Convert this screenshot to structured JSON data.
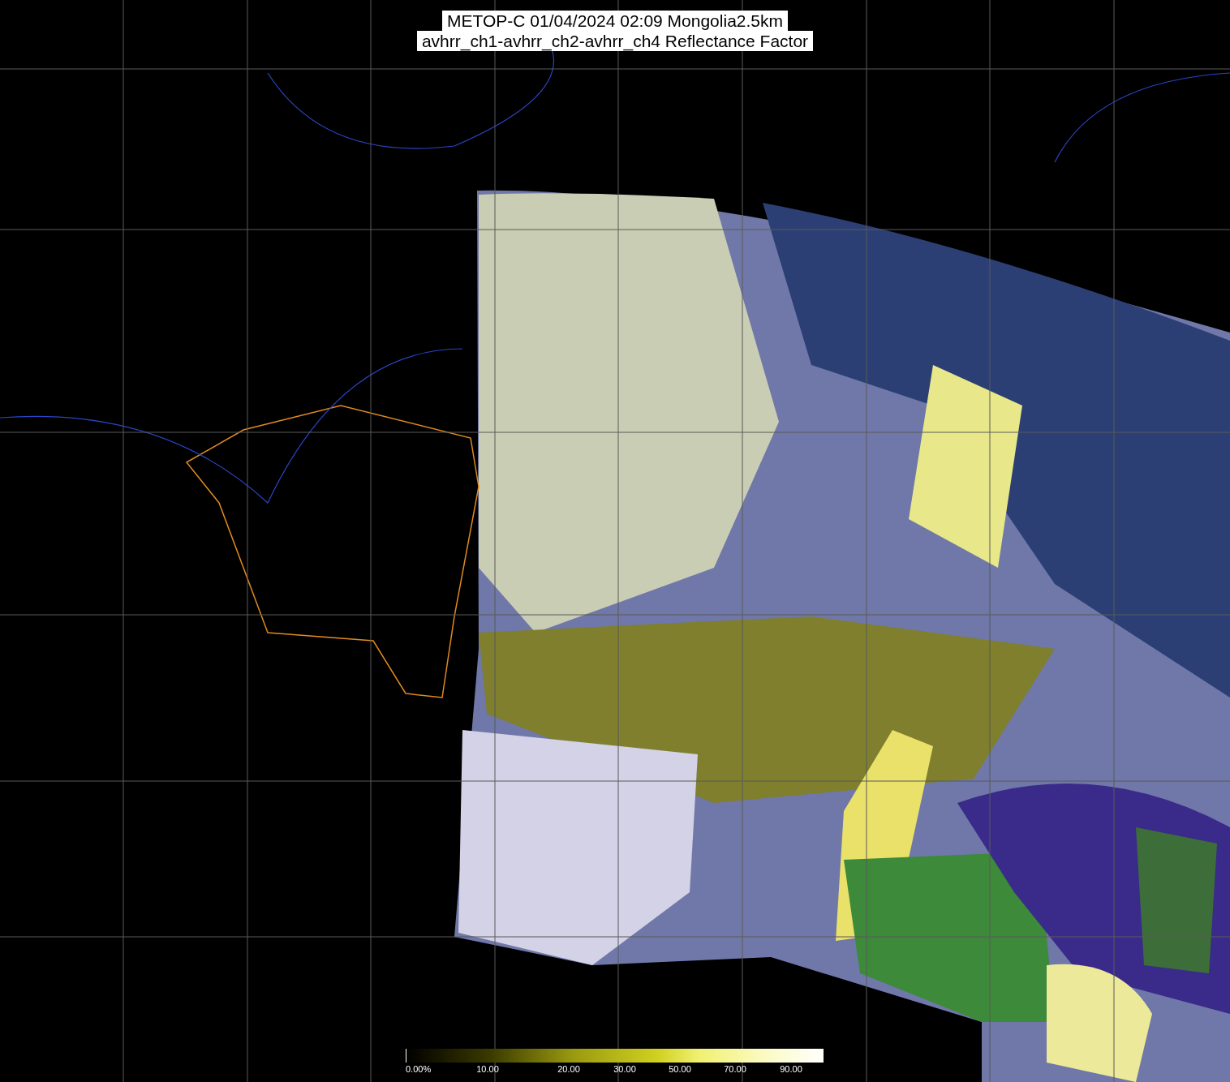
{
  "title": {
    "line_1": "METOP-C 01/04/2024 02:09 Mongolia2.5km",
    "line_2": "avhrr_ch1-avhrr_ch2-avhrr_ch4 Reflectance Factor"
  },
  "colorbar": {
    "ticks": [
      "0.00%",
      "10.00",
      "20.00",
      "30.00",
      "50.00",
      "70.00",
      "90.00"
    ]
  }
}
